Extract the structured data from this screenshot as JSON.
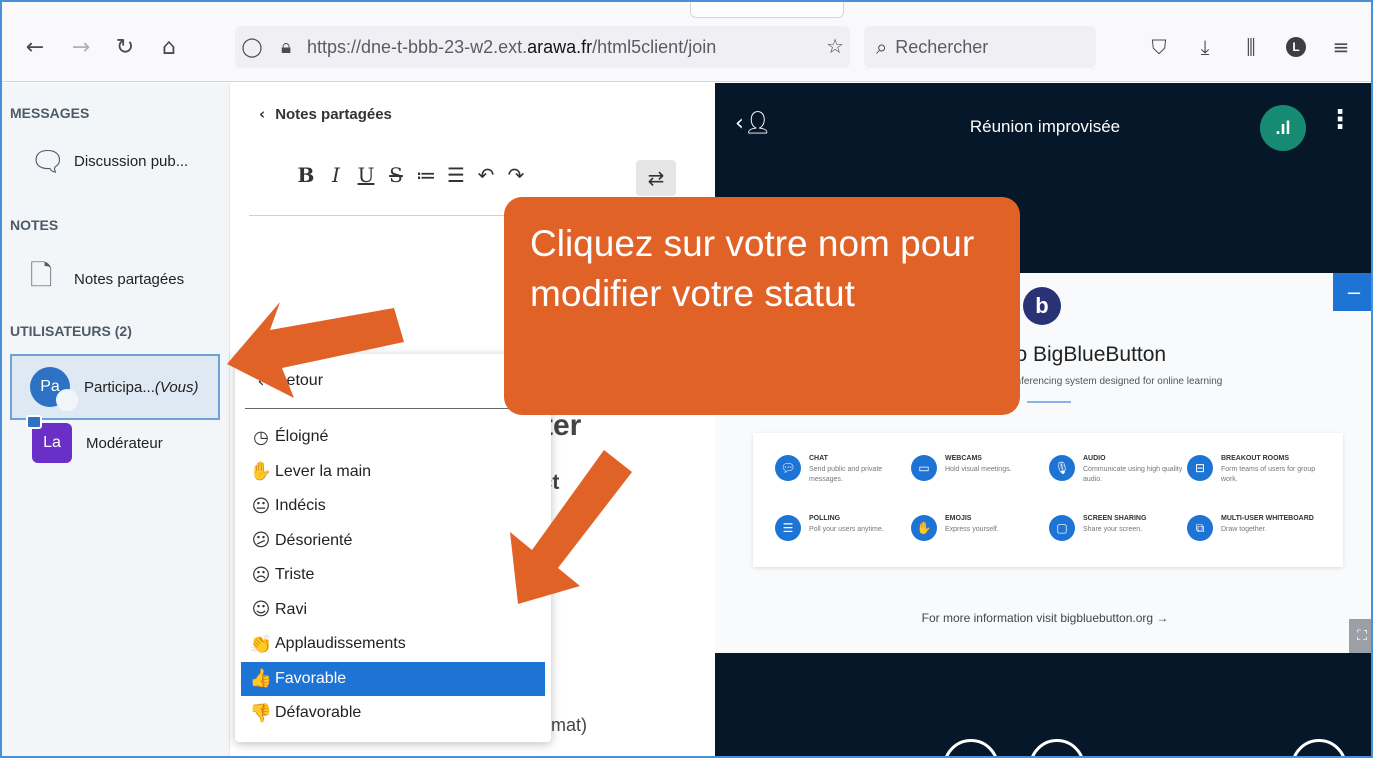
{
  "browser": {
    "url_prefix": "https://dne-t-bbb-23-w2.ext.",
    "url_domain": "arawa.fr",
    "url_suffix": "/html5client/join",
    "search_placeholder": "Rechercher",
    "account_initial": "L"
  },
  "sidebar": {
    "messages_title": "MESSAGES",
    "public_chat_label": "Discussion pub...",
    "notes_title": "NOTES",
    "shared_notes_label": "Notes partagées",
    "users_title": "UTILISATEURS (2)",
    "users": [
      {
        "initials": "Pa",
        "name": "Participa...",
        "suffix": "(Vous)"
      },
      {
        "initials": "La",
        "name": "Modérateur"
      }
    ]
  },
  "notes_panel": {
    "header": "Notes partagées",
    "format_buttons": [
      "B",
      "I",
      "U",
      "S",
      "≔",
      "☰",
      "↶",
      "↷"
    ],
    "fragments": {
      "heading": "ter",
      "line": "act    en :",
      "footer": "rmat)"
    }
  },
  "status_menu": {
    "back_label": "Retour",
    "items": [
      {
        "icon": "clock-icon",
        "glyph": "◷",
        "label": "Éloigné"
      },
      {
        "icon": "hand-icon",
        "glyph": "✋",
        "label": "Lever la main"
      },
      {
        "icon": "neutral-face-icon",
        "glyph": "😐",
        "label": "Indécis"
      },
      {
        "icon": "confused-face-icon",
        "glyph": "😕",
        "label": "Désorienté"
      },
      {
        "icon": "sad-face-icon",
        "glyph": "☹",
        "label": "Triste"
      },
      {
        "icon": "happy-face-icon",
        "glyph": "☺",
        "label": "Ravi"
      },
      {
        "icon": "applause-icon",
        "glyph": "👏",
        "label": "Applaudissements"
      },
      {
        "icon": "thumbs-up-icon",
        "glyph": "👍",
        "label": "Favorable",
        "selected": true
      },
      {
        "icon": "thumbs-down-icon",
        "glyph": "👎",
        "label": "Défavorable"
      }
    ]
  },
  "presentation": {
    "meeting_title": "Réunion improvisée",
    "slide_title": "To BigBlueButton",
    "slide_subtitle": "conferencing system designed for online learning",
    "features": [
      {
        "title": "CHAT",
        "desc": "Send public and private messages."
      },
      {
        "title": "WEBCAMS",
        "desc": "Hold visual meetings."
      },
      {
        "title": "AUDIO",
        "desc": "Communicate using high quality audio."
      },
      {
        "title": "BREAKOUT ROOMS",
        "desc": "Form teams of users for group work."
      },
      {
        "title": "POLLING",
        "desc": "Poll your users anytime."
      },
      {
        "title": "EMOJIS",
        "desc": "Express yourself."
      },
      {
        "title": "SCREEN SHARING",
        "desc": "Share your screen."
      },
      {
        "title": "MULTI-USER WHITEBOARD",
        "desc": "Draw together."
      }
    ],
    "footer": "For more information visit bigbluebutton.org →"
  },
  "callout": {
    "text": "Cliquez sur votre nom pour modifier votre statut"
  },
  "colors": {
    "accent": "#1e74d5",
    "callout": "#e06227",
    "presentation_bg": "#06172a",
    "connection": "#168a72"
  }
}
